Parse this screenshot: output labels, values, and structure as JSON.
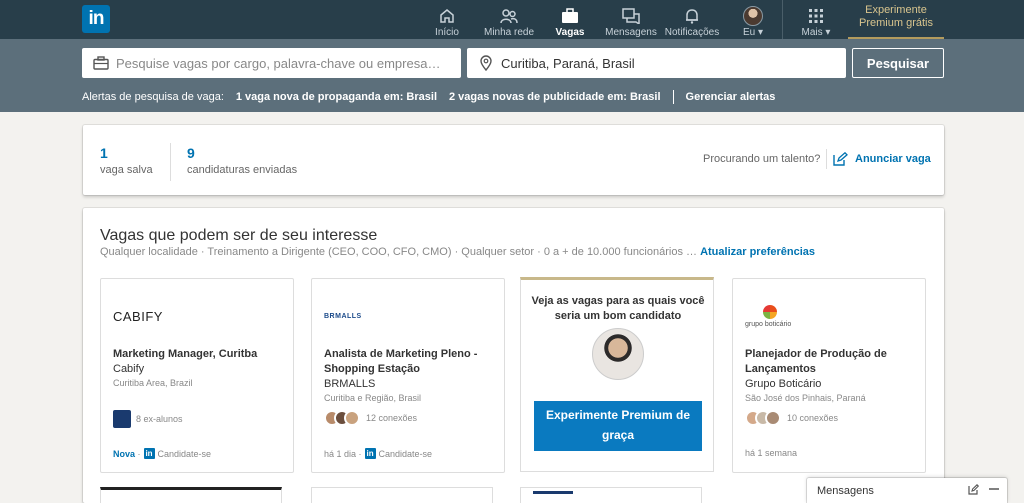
{
  "nav": {
    "logo": "in",
    "items": [
      {
        "label": "Início",
        "icon": "home-icon"
      },
      {
        "label": "Minha rede",
        "icon": "network-icon"
      },
      {
        "label": "Vagas",
        "icon": "jobs-icon"
      },
      {
        "label": "Mensagens",
        "icon": "messages-icon"
      },
      {
        "label": "Notificações",
        "icon": "bell-icon"
      },
      {
        "label": "Eu",
        "icon": "avatar"
      },
      {
        "label": "Mais",
        "icon": "grid-icon"
      }
    ],
    "premium_line1": "Experimente",
    "premium_line2": "Premium grátis"
  },
  "search": {
    "keyword_placeholder": "Pesquise vagas por cargo, palavra-chave ou empresa…",
    "location_value": "Curitiba, Paraná, Brasil",
    "button": "Pesquisar"
  },
  "alerts": {
    "label": "Alertas de pesquisa de vaga:",
    "alert1": "1 vaga nova de propaganda em: Brasil",
    "alert2": "2 vagas novas de publicidade em: Brasil",
    "manage": "Gerenciar alertas"
  },
  "stats": {
    "saved_count": "1",
    "saved_label": "vaga salva",
    "applied_count": "9",
    "applied_label": "candidaturas enviadas",
    "talent_text": "Procurando um talento?",
    "post_job": "Anunciar vaga"
  },
  "jobs": {
    "title": "Vagas que podem ser de seu interesse",
    "filters": "Qualquer localidade  ·  Treinamento a Dirigente (CEO, COO, CFO, CMO)  ·  Qualquer setor  ·  0 a + de 10.000 funcionários … ",
    "update_prefs": "Atualizar preferências",
    "cards": [
      {
        "logo": "CABIFY",
        "title": "Marketing Manager, Curitba",
        "company": "Cabify",
        "location": "Curitiba Area, Brazil",
        "connections": "8 ex-alunos",
        "time": "Nova",
        "apply": "Candidate-se"
      },
      {
        "logo": "BRMALLS",
        "title": "Analista de Marketing Pleno - Shopping Estação",
        "company": "BRMALLS",
        "location": "Curitiba e Região, Brasil",
        "connections": "12 conexões",
        "time": "há 1 dia",
        "apply": "Candidate-se"
      },
      {
        "logo": "grupo boticário",
        "title": "Planejador de Produção de Lançamentos",
        "company": "Grupo Boticário",
        "location": "São José dos Pinhais, Paraná",
        "connections": "10 conexões",
        "time": "há 1 semana",
        "apply": ""
      }
    ],
    "premium_card": {
      "text": "Veja as vagas para as quais você seria um bom candidato",
      "button": "Experimente Premium de graça"
    }
  },
  "messaging": {
    "label": "Mensagens"
  }
}
